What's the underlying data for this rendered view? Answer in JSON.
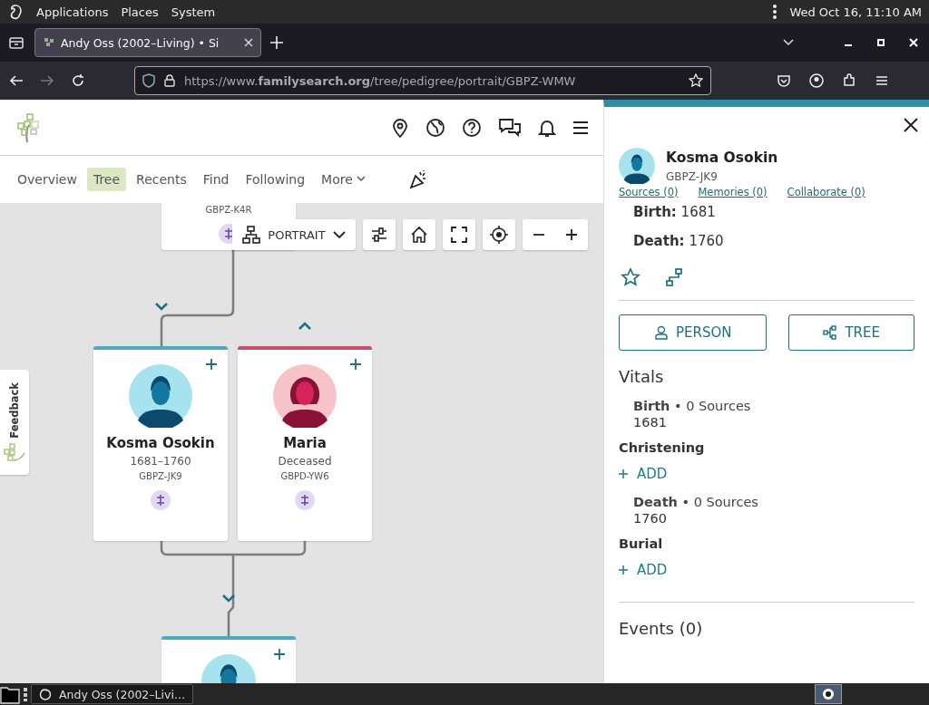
{
  "system_bar": {
    "menus": [
      "Applications",
      "Places",
      "System"
    ],
    "clock": "Wed Oct 16, 11:10 AM"
  },
  "browser": {
    "tabs": [
      {
        "title": "Andy Oss (2002–Living) • Si",
        "selected": true
      }
    ],
    "url": "https://www.**familysearch.org**/tree/pedigree/portrait/GBPZ-WMW"
  },
  "site_nav": [
    {
      "label": "Overview",
      "selected": false
    },
    {
      "label": "Tree",
      "selected": true
    },
    {
      "label": "Recents",
      "selected": false
    },
    {
      "label": "Find",
      "selected": false
    },
    {
      "label": "Following",
      "selected": false
    },
    {
      "label": "More",
      "selected": false,
      "kind": "menu"
    }
  ],
  "tree_toolbar": {
    "view": "PORTRAIT"
  },
  "feedback": "Feedback",
  "cards": [
    {
      "kind": "partial",
      "pid": "GBPZ-K4R"
    },
    {
      "kind": "male",
      "name": "Kosma Osokin",
      "lifespan": "1681–1760",
      "pid": "GBPZ-JK9",
      "color": "#4fa8c4"
    },
    {
      "kind": "female",
      "name": "Maria",
      "lifespan": "Deceased",
      "pid": "GBPD-YW6",
      "color": "#c8506a"
    },
    {
      "kind": "male",
      "color": "#4fa8c4"
    }
  ],
  "panel": {
    "name": "Kosma Osokin",
    "pid": "GBPZ-JK9",
    "links": [
      "Sources (0)",
      "Memories (0)",
      "Collaborate (0)"
    ],
    "facts": [
      "**Birth:** 1681",
      "**Death:** 1760"
    ],
    "buttons": [
      {
        "kind": "person",
        "label": "PERSON"
      },
      {
        "kind": "tree",
        "label": "TREE"
      }
    ],
    "vitals_title": "Vitals",
    "vitals": [
      {
        "kind": "fact",
        "heading": "**Birth** • 0 Sources",
        "value": "1681"
      },
      {
        "kind": "empty",
        "heading": "Christening",
        "action": "ADD"
      },
      {
        "kind": "fact",
        "heading": "**Death** • 0 Sources",
        "value": "1760"
      },
      {
        "kind": "empty",
        "heading": "Burial",
        "action": "ADD"
      }
    ],
    "events_title": "Events (0)"
  },
  "taskbar": {
    "tasks": [
      "Andy Oss (2002–Livi…"
    ]
  }
}
